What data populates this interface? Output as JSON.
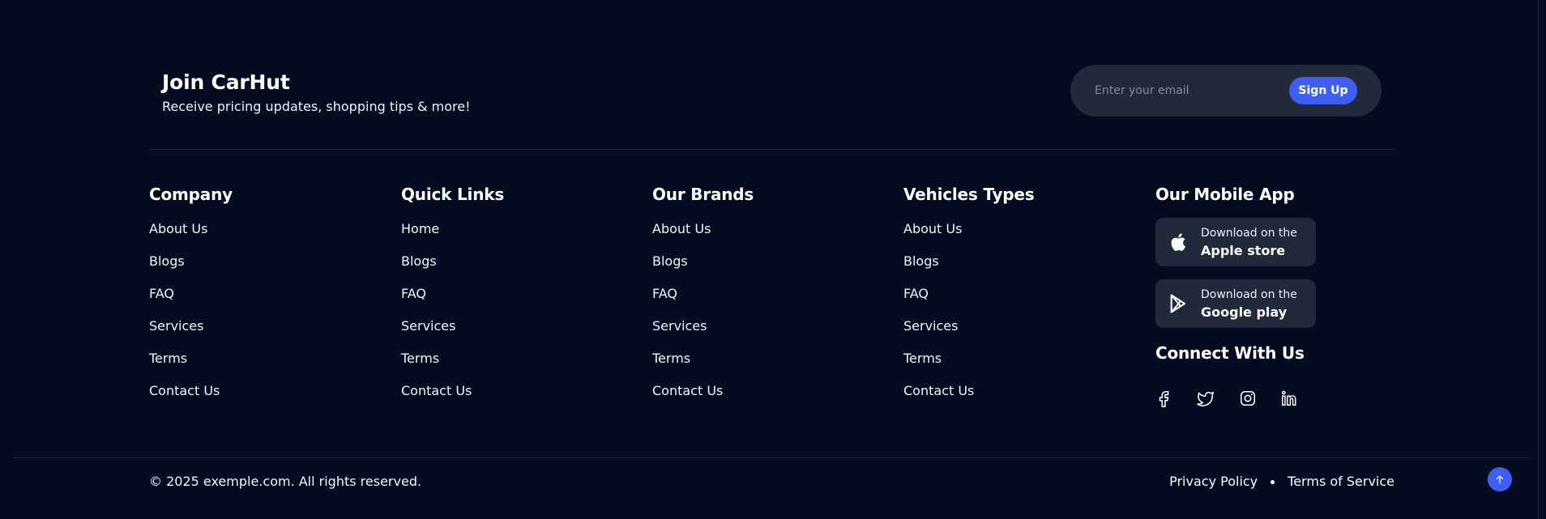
{
  "newsletter": {
    "title": "Join CarHut",
    "subtitle": "Receive pricing updates, shopping tips & more!",
    "email_placeholder": "Enter your email",
    "signup_label": "Sign Up"
  },
  "columns": [
    {
      "title": "Company",
      "links": [
        "About Us",
        "Blogs",
        "FAQ",
        "Services",
        "Terms",
        "Contact Us"
      ]
    },
    {
      "title": "Quick Links",
      "links": [
        "Home",
        "Blogs",
        "FAQ",
        "Services",
        "Terms",
        "Contact Us"
      ]
    },
    {
      "title": "Our Brands",
      "links": [
        "About Us",
        "Blogs",
        "FAQ",
        "Services",
        "Terms",
        "Contact Us"
      ]
    },
    {
      "title": "Vehicles Types",
      "links": [
        "About Us",
        "Blogs",
        "FAQ",
        "Services",
        "Terms",
        "Contact Us"
      ]
    }
  ],
  "mobile_app": {
    "title": "Our Mobile App",
    "apple": {
      "small": "Download on the",
      "big": "Apple store",
      "icon": "apple-icon"
    },
    "google": {
      "small": "Download on the",
      "big": "Google play",
      "icon": "google-play-icon"
    }
  },
  "connect": {
    "title": "Connect With Us",
    "icons": [
      "facebook-icon",
      "twitter-icon",
      "instagram-icon",
      "linkedin-icon"
    ]
  },
  "bottom": {
    "copyright": "© 2025 exemple.com. All rights reserved.",
    "privacy": "Privacy Policy",
    "terms": "Terms of Service"
  },
  "colors": {
    "background": "#050b20",
    "card": "#22293b",
    "accent": "#405ff2"
  }
}
